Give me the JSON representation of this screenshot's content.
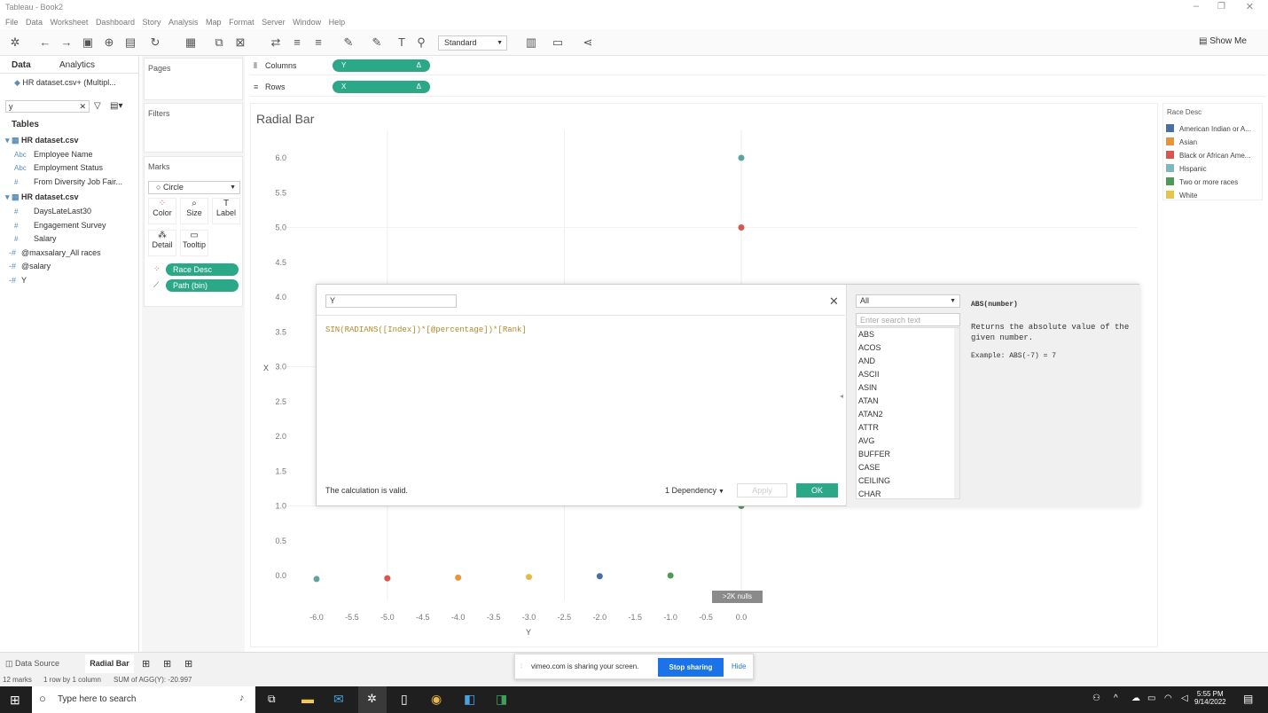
{
  "window": {
    "title": "Tableau - Book2"
  },
  "menu": [
    "File",
    "Data",
    "Worksheet",
    "Dashboard",
    "Story",
    "Analysis",
    "Map",
    "Format",
    "Server",
    "Window",
    "Help"
  ],
  "toolbar": {
    "mark_size_dropdown": "Standard",
    "show_me": "Show Me"
  },
  "left_pane": {
    "tabs": [
      "Data",
      "Analytics"
    ],
    "datasource": "HR dataset.csv+ (Multipl...",
    "search_value": "y",
    "tables_heading": "Tables",
    "table1": "HR dataset.csv",
    "table1_fields": [
      "Employee Name",
      "Employment Status",
      "From Diversity Job Fair..."
    ],
    "table2": "HR dataset.csv",
    "table2_fields": [
      "DaysLateLast30",
      "Engagement Survey",
      "Salary"
    ],
    "params": [
      "@maxsalary_All races",
      "@salary",
      "Y"
    ]
  },
  "cards": {
    "pages": "Pages",
    "filters": "Filters",
    "marks": "Marks",
    "mark_type": "Circle",
    "buttons": [
      "Color",
      "Size",
      "Label",
      "Detail",
      "Tooltip"
    ],
    "pills": [
      "Race Desc",
      "Path (bin)"
    ]
  },
  "shelves": {
    "columns_label": "Columns",
    "columns_pill": "Y",
    "rows_label": "Rows",
    "rows_pill": "X",
    "delta": "Δ"
  },
  "view": {
    "title": "Radial Bar",
    "x_axis_label": "Y",
    "y_axis_label": "X",
    "nulls_badge": ">2K nulls"
  },
  "chart_data": {
    "type": "scatter",
    "title": "Radial Bar",
    "xlabel": "Y",
    "ylabel": "X",
    "x_ticks": [
      "-6.0",
      "-5.5",
      "-5.0",
      "-4.5",
      "-4.0",
      "-3.5",
      "-3.0",
      "-2.5",
      "-2.0",
      "-1.5",
      "-1.0",
      "-0.5",
      "0.0"
    ],
    "y_ticks": [
      "0.0",
      "0.5",
      "1.0",
      "1.5",
      "2.0",
      "2.5",
      "3.0",
      "3.5",
      "4.0",
      "4.5",
      "5.0",
      "5.5",
      "6.0"
    ],
    "xlim": [
      -6.0,
      0.0
    ],
    "ylim": [
      0.0,
      6.0
    ],
    "points": [
      {
        "x": -6.0,
        "y": -0.05,
        "color": "#5fa2a0"
      },
      {
        "x": -5.0,
        "y": -0.04,
        "color": "#d7574f"
      },
      {
        "x": -4.0,
        "y": -0.03,
        "color": "#e8943f"
      },
      {
        "x": -3.0,
        "y": -0.02,
        "color": "#e8b94a"
      },
      {
        "x": -2.0,
        "y": -0.01,
        "color": "#4a6fa5"
      },
      {
        "x": -1.0,
        "y": 0.0,
        "color": "#4f9a55"
      },
      {
        "x": 0.0,
        "y": 6.0,
        "color": "#5fa2a0"
      },
      {
        "x": 0.0,
        "y": 5.0,
        "color": "#d7574f"
      },
      {
        "x": 0.0,
        "y": 1.0,
        "color": "#4f9a55"
      }
    ]
  },
  "legend": {
    "title": "Race Desc",
    "items": [
      {
        "label": "American Indian or A...",
        "color": "#4a6fa5"
      },
      {
        "label": "Asian",
        "color": "#e8943f"
      },
      {
        "label": "Black or African Ame...",
        "color": "#d7574f"
      },
      {
        "label": "Hispanic",
        "color": "#7fb6c2"
      },
      {
        "label": "Two or more races",
        "color": "#4f9a55"
      },
      {
        "label": "White",
        "color": "#e8c44a"
      }
    ]
  },
  "dialog": {
    "name": "Y",
    "formula": "SIN(RADIANS([Index])*[@percentage])*[Rank]",
    "status": "The calculation is valid.",
    "dependency": "1 Dependency",
    "apply": "Apply",
    "ok": "OK",
    "category": "All",
    "search_placeholder": "Enter search text",
    "functions": [
      "ABS",
      "ACOS",
      "AND",
      "ASCII",
      "ASIN",
      "ATAN",
      "ATAN2",
      "ATTR",
      "AVG",
      "BUFFER",
      "CASE",
      "CEILING",
      "CHAR"
    ],
    "help_title": "ABS(number)",
    "help_text": "Returns the absolute value of the given number.",
    "help_example": "Example: ABS(-7) = 7"
  },
  "bottom": {
    "tabs": [
      "Data Source",
      "Radial Bar"
    ]
  },
  "status": {
    "marks": "12 marks",
    "rows": "1 row by 1 column",
    "sum": "SUM of AGG(Y): -20.997"
  },
  "share_bar": {
    "text": "vimeo.com is sharing your screen.",
    "stop": "Stop sharing",
    "hide": "Hide"
  },
  "taskbar": {
    "search": "Type here to search",
    "time": "5:55 PM",
    "date": "9/14/2022"
  }
}
